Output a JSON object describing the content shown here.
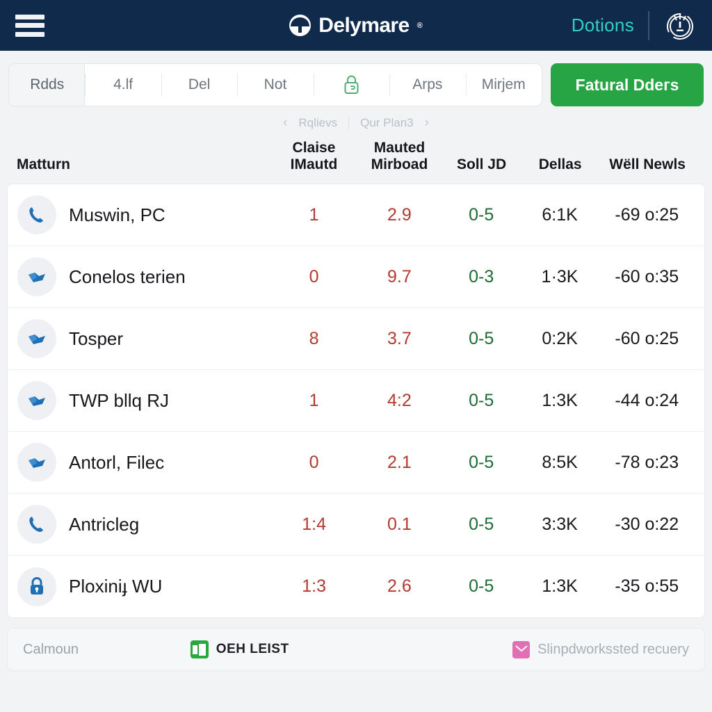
{
  "header": {
    "menu_icon": "hamburger-menu-icon",
    "brand_name": "Delymare",
    "brand_reg": "®",
    "link_label": "Dotions",
    "badge_icon": "award-badge-icon"
  },
  "tabbar": {
    "tabs": [
      {
        "label": "Rdds",
        "active": true
      },
      {
        "label": "4.lf",
        "active": false
      },
      {
        "label": "Del",
        "active": false
      },
      {
        "label": "Not",
        "active": false
      },
      {
        "label": "",
        "icon": "lock-icon",
        "active": false
      },
      {
        "label": "Arps",
        "active": false
      },
      {
        "label": "Mirjem",
        "active": false
      }
    ],
    "cta_label": "Fatural Ddeгs"
  },
  "subnav": {
    "prev_icon": "chevron-left-icon",
    "prev_label": "Rqlievs",
    "next_label": "Qur Plan3",
    "next_icon": "chevron-right-icon"
  },
  "table": {
    "columns": [
      "Matturn",
      "Claise IMautd",
      "Mauted Mirboad",
      "Soll JD",
      "Dellas",
      "Wëll Newls"
    ],
    "columns_split": [
      [
        "Matturn",
        ""
      ],
      [
        "Claise",
        "IMautd"
      ],
      [
        "Mauted",
        "Mirboad"
      ],
      [
        "Soll JD",
        ""
      ],
      [
        "Dellas",
        ""
      ],
      [
        "Wëll Newls",
        ""
      ]
    ],
    "rows": [
      {
        "icon": "phone-icon",
        "name": "Muswin, PC",
        "c1": "1",
        "c2": "2.9",
        "c3": "0-5",
        "c4": "6:1K",
        "c5": "-69 o:25"
      },
      {
        "icon": "flag-icon",
        "name": "Conelos terien",
        "c1": "0",
        "c2": "9.7",
        "c3": "0-3",
        "c4": "1·3K",
        "c5": "-60 o:35"
      },
      {
        "icon": "flag-icon",
        "name": "Tosper",
        "c1": "8",
        "c2": "3.7",
        "c3": "0-5",
        "c4": "0:2K",
        "c5": "-60 o:25"
      },
      {
        "icon": "flag-icon",
        "name": "TWP bllq RJ",
        "c1": "1",
        "c2": "4:2",
        "c3": "0-5",
        "c4": "1:3K",
        "c5": "-44 o:24"
      },
      {
        "icon": "flag-icon",
        "name": "Antorl, Filec",
        "c1": "0",
        "c2": "2.1",
        "c3": "0-5",
        "c4": "8:5K",
        "c5": "-78 o:23"
      },
      {
        "icon": "phone-icon",
        "name": "Antricleg",
        "c1": "1:4",
        "c2": "0.1",
        "c3": "0-5",
        "c4": "3:3K",
        "c5": "-30 o:22"
      },
      {
        "icon": "lock-icon",
        "name": "Ploxiniɟ WU",
        "c1": "1:3",
        "c2": "2.6",
        "c3": "0-5",
        "c4": "1:3K",
        "c5": "-35 o:55"
      }
    ]
  },
  "footer": {
    "left_label": "Calmoun",
    "mid_icon": "app-tile-icon",
    "mid_label": "OEH LEIST",
    "right_icon": "envelope-icon",
    "right_label": "Slinpdworkssted recuery"
  },
  "colors": {
    "header_bg": "#102a4c",
    "accent_teal": "#35cfc4",
    "cta_green": "#27a544",
    "value_red": "#b33a2e",
    "value_green": "#1d6b33",
    "icon_blue": "#1f6fb5",
    "footer_green": "#2aa73f",
    "footer_pink": "#e06fb4"
  }
}
